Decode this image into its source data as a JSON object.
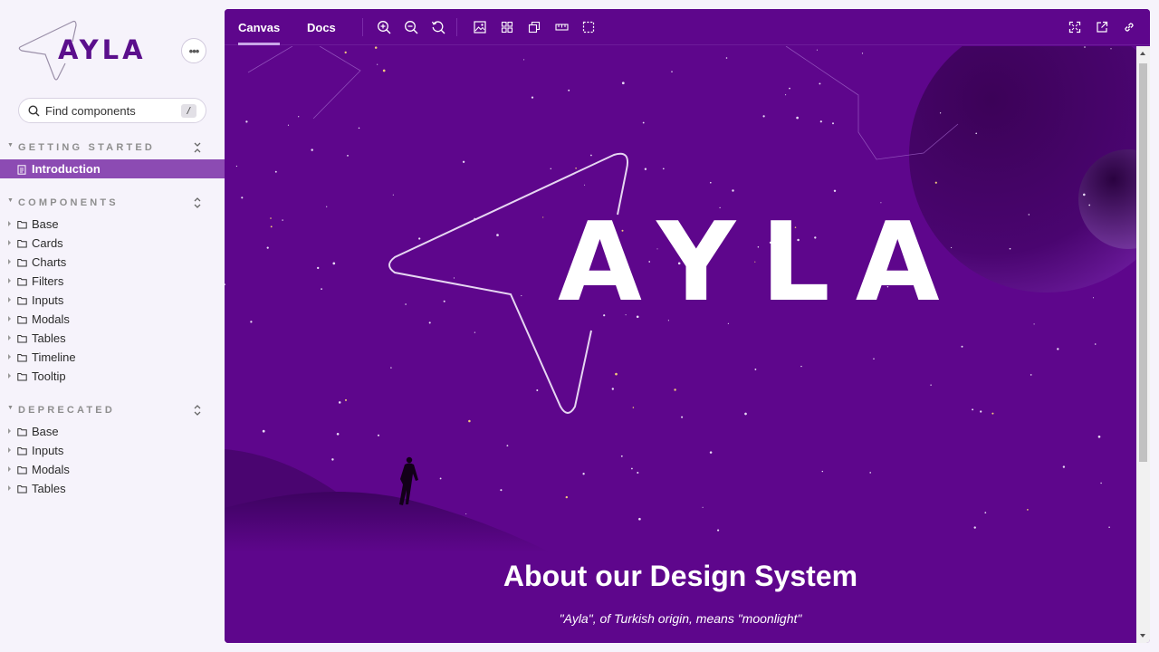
{
  "sidebar": {
    "brand": "AYLA",
    "search": {
      "placeholder": "Find components",
      "shortcut": "/"
    },
    "sections": [
      {
        "title": "GETTING STARTED",
        "items": [
          {
            "label": "Introduction",
            "type": "doc",
            "active": true
          }
        ]
      },
      {
        "title": "COMPONENTS",
        "items": [
          {
            "label": "Base"
          },
          {
            "label": "Cards"
          },
          {
            "label": "Charts"
          },
          {
            "label": "Filters"
          },
          {
            "label": "Inputs"
          },
          {
            "label": "Modals"
          },
          {
            "label": "Tables"
          },
          {
            "label": "Timeline"
          },
          {
            "label": "Tooltip"
          }
        ]
      },
      {
        "title": "DEPRECATED",
        "items": [
          {
            "label": "Base"
          },
          {
            "label": "Inputs"
          },
          {
            "label": "Modals"
          },
          {
            "label": "Tables"
          }
        ]
      }
    ]
  },
  "toolbar": {
    "tabs": [
      {
        "label": "Canvas",
        "active": true
      },
      {
        "label": "Docs",
        "active": false
      }
    ],
    "tools": [
      "zoom-in-icon",
      "zoom-out-icon",
      "reset-zoom-icon",
      "background-icon",
      "grid-icon",
      "viewport-icon",
      "measure-icon",
      "outline-icon"
    ],
    "right_tools": [
      "fullscreen-icon",
      "open-new-tab-icon",
      "copy-link-icon"
    ]
  },
  "canvas": {
    "logo_text": "AYLA",
    "heading": "About our Design System",
    "subtitle": "\"Ayla\", of Turkish origin, means \"moonlight\""
  },
  "colors": {
    "brand": "#5e068c",
    "sidebar_bg": "#f6f3fb",
    "active_item": "#8c4bb3"
  }
}
